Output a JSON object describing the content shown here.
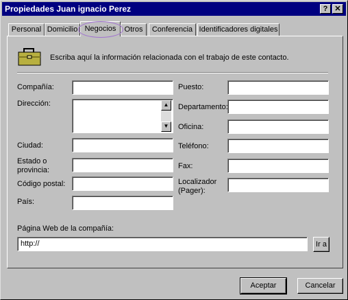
{
  "window": {
    "title": "Propiedades Juan ignacio Perez",
    "help_glyph": "?",
    "close_glyph": "✕"
  },
  "tabs": [
    {
      "label": "Personal",
      "active": false
    },
    {
      "label": "Domicilio",
      "active": false
    },
    {
      "label": "Negocios",
      "active": true
    },
    {
      "label": "Otros",
      "active": false
    },
    {
      "label": "Conferencia",
      "active": false
    },
    {
      "label": "Identificadores digitales",
      "active": false
    }
  ],
  "header": {
    "icon": "briefcase-icon",
    "text": "Escriba aquí la información relacionada con el trabajo de este contacto."
  },
  "left_fields": {
    "company": {
      "label": "Compañía:",
      "value": ""
    },
    "address": {
      "label": "Dirección:",
      "value": ""
    },
    "city": {
      "label": "Ciudad:",
      "value": ""
    },
    "state_line1": "Estado o",
    "state_line2": "provincia:",
    "state_value": "",
    "postal": {
      "label": "Código postal:",
      "value": ""
    },
    "country": {
      "label": "País:",
      "value": ""
    }
  },
  "right_fields": {
    "job": {
      "label": "Puesto:",
      "value": ""
    },
    "department": {
      "label": "Departamento:",
      "value": ""
    },
    "office": {
      "label": "Oficina:",
      "value": ""
    },
    "phone": {
      "label": "Teléfono:",
      "value": ""
    },
    "fax": {
      "label": "Fax:",
      "value": ""
    },
    "pager_line1": "Localizador",
    "pager_line2": "(Pager):",
    "pager_value": ""
  },
  "web": {
    "label": "Página Web de la compañía:",
    "value": "http://",
    "go_button": "Ir a"
  },
  "buttons": {
    "ok": "Aceptar",
    "cancel": "Cancelar"
  },
  "colors": {
    "titlebar": "#000080",
    "face": "#c0c0c0",
    "tab_highlight": "#a070d0"
  }
}
